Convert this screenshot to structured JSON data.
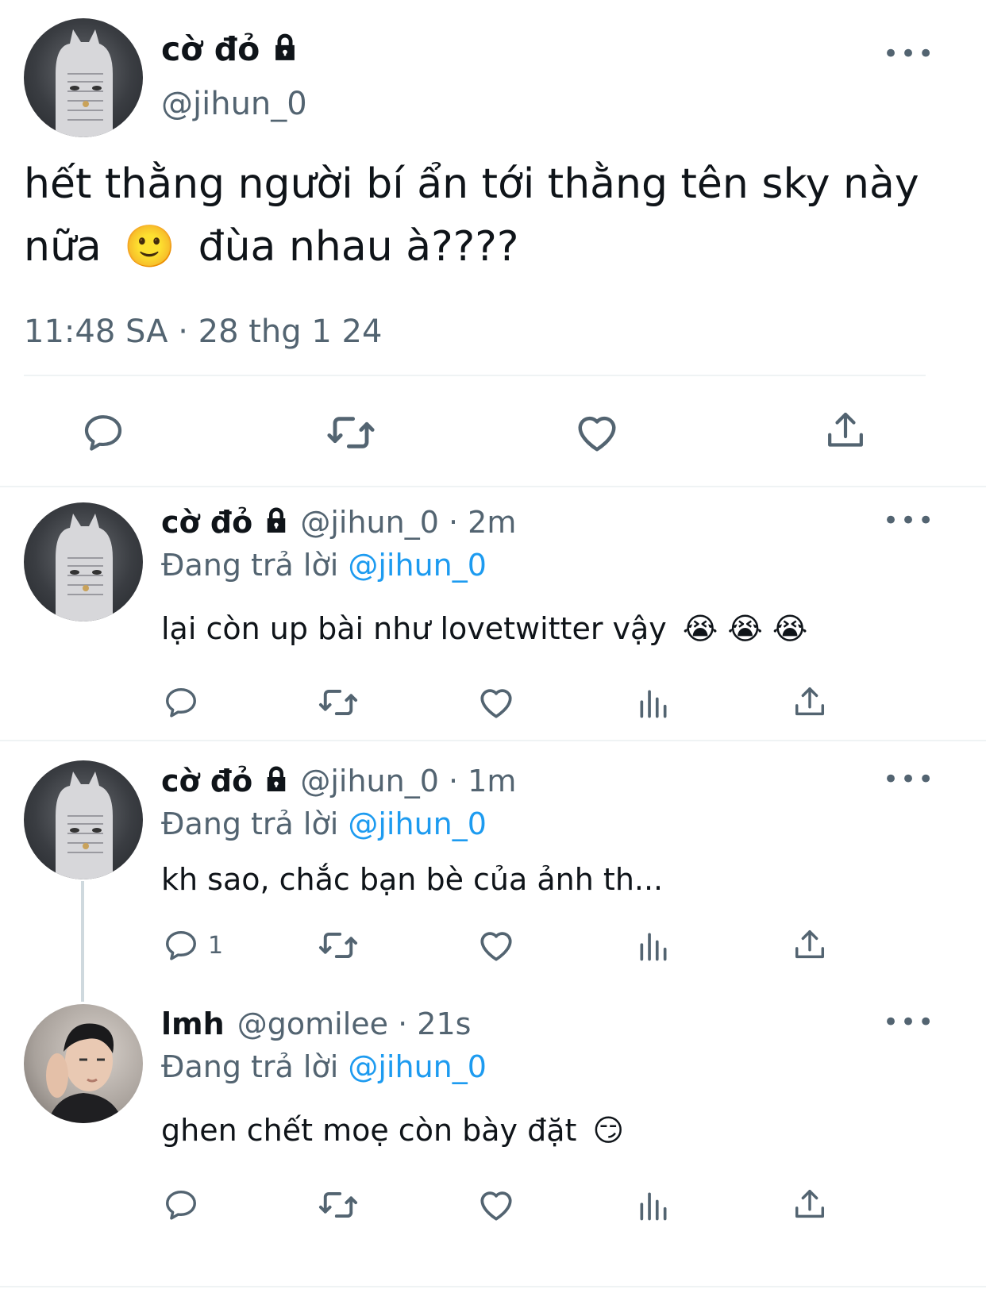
{
  "main_tweet": {
    "display_name": "cờ đỏ",
    "handle": "@jihun_0",
    "text_line1": "hết thằng người bí ẩn tới thằng tên sky này",
    "text_line2_a": "nữa",
    "emoji": "🙂",
    "text_line2_b": "đùa nhau à????",
    "timestamp": "11:48 SA · 28 thg 1 24"
  },
  "replies": [
    {
      "display_name": "cờ đỏ",
      "meta": "@jihun_0 · 2m",
      "replying_prefix": "Đang trả lời",
      "replying_to": "@jihun_0",
      "text": "lại còn up bài như lovetwitter vậy",
      "emojis": "😭 😭 😭",
      "reply_count": ""
    },
    {
      "display_name": "cờ đỏ",
      "meta": "@jihun_0 · 1m",
      "replying_prefix": "Đang trả lời",
      "replying_to": "@jihun_0",
      "text": "kh sao, chắc bạn bè của ảnh th...",
      "emojis": "",
      "reply_count": "1"
    },
    {
      "display_name": "lmh",
      "meta": "@gomilee · 21s",
      "replying_prefix": "Đang trả lời",
      "replying_to": "@jihun_0",
      "text": "ghen chết moẹ còn bày đặt",
      "emojis": "😏",
      "reply_count": ""
    }
  ],
  "icons": {
    "more": "more-options-icon",
    "lock": "lock-icon",
    "reply": "reply-icon",
    "retweet": "retweet-icon",
    "like": "heart-icon",
    "views": "views-icon",
    "share": "share-icon"
  },
  "colors": {
    "text": "#0f1419",
    "secondary": "#536471",
    "link": "#1d9bf0",
    "divider": "#eff3f4"
  }
}
